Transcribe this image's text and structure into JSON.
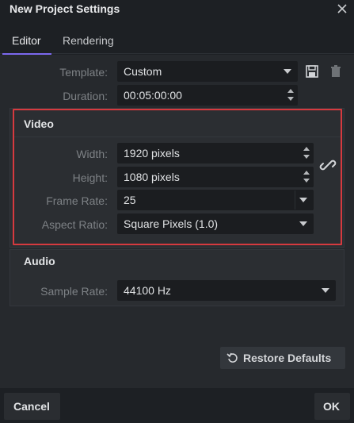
{
  "dialog": {
    "title": "New Project Settings"
  },
  "tabs": [
    {
      "label": "Editor",
      "active": true
    },
    {
      "label": "Rendering",
      "active": false
    }
  ],
  "editor": {
    "template": {
      "label": "Template:",
      "value": "Custom"
    },
    "duration": {
      "label": "Duration:",
      "value": "00:05:00:00"
    },
    "video": {
      "heading": "Video",
      "width": {
        "label": "Width:",
        "value": "1920 pixels"
      },
      "height": {
        "label": "Height:",
        "value": "1080 pixels"
      },
      "frame_rate": {
        "label": "Frame Rate:",
        "value": "25"
      },
      "aspect_ratio": {
        "label": "Aspect Ratio:",
        "value": "Square Pixels (1.0)"
      }
    },
    "audio": {
      "heading": "Audio",
      "sample_rate": {
        "label": "Sample Rate:",
        "value": "44100 Hz"
      }
    }
  },
  "buttons": {
    "restore_defaults": "Restore Defaults",
    "cancel": "Cancel",
    "ok": "OK"
  },
  "icons": {
    "close": "close-icon",
    "save": "save-icon",
    "delete": "trash-icon",
    "link": "link-icon",
    "restore": "restore-icon"
  },
  "colors": {
    "accent": "#7b68ee",
    "highlight": "#d63a3f",
    "background": "#1d2024",
    "panel": "#26292d"
  }
}
